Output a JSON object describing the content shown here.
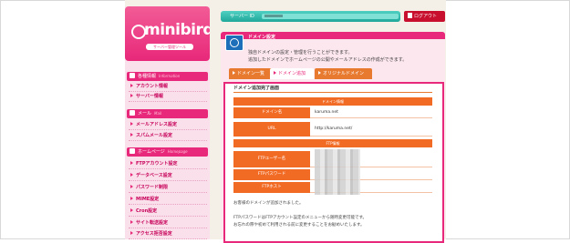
{
  "logo": {
    "name": "minibird",
    "subtitle": "サーバー管理ツール"
  },
  "sidebar": {
    "sections": [
      {
        "label": "各種情報",
        "en": "Information",
        "items": [
          "アカウント情報",
          "サーバー情報"
        ]
      },
      {
        "label": "メール",
        "en": "Mail",
        "items": [
          "メールアドレス設定",
          "スパムメール設定"
        ]
      },
      {
        "label": "ホームページ",
        "en": "Homepage",
        "items": [
          "FTPアカウント設定",
          "データベース設定",
          "パスワード制限",
          "MIME設定",
          "Cron設定",
          "サイト転送設定",
          "アクセス拒否設定"
        ]
      }
    ]
  },
  "topbar": {
    "server_id_label": "サーバー ID",
    "logout_label": "ログアウト"
  },
  "panel": {
    "title": "ドメイン設定",
    "desc1": "独自ドメインの設定・管理を行うことができます。",
    "desc2": "追加したドメインでホームページの公開やメールアドレスの作成ができます。",
    "tabs": [
      "ドメイン一覧",
      "ドメイン追加",
      "オリジナルドメイン"
    ]
  },
  "result": {
    "title": "ドメイン追加完了画面",
    "domain_info_header": "ドメイン情報",
    "domain_label": "ドメイン名",
    "domain_value": "karuma.net",
    "url_label": "URL",
    "url_value": "http://karuma.net/",
    "ftp_header": "FTP情報",
    "ftp_user_label": "FTPユーザー名",
    "ftp_password_label": "FTPパスワード",
    "ftp_host_label": "FTPホスト",
    "note1": "お客様のドメインが追加されました。",
    "note2": "FTPパスワードはFTPアカウント設定のメニューから随時変更可能です。",
    "note3": "お忘れの際や初めて利用される前に変更することをお勧めいたします。"
  },
  "colors": {
    "accent": "#e8287a",
    "orange": "#f26b25",
    "teal": "#1fa89a",
    "logout": "#c8102e"
  }
}
